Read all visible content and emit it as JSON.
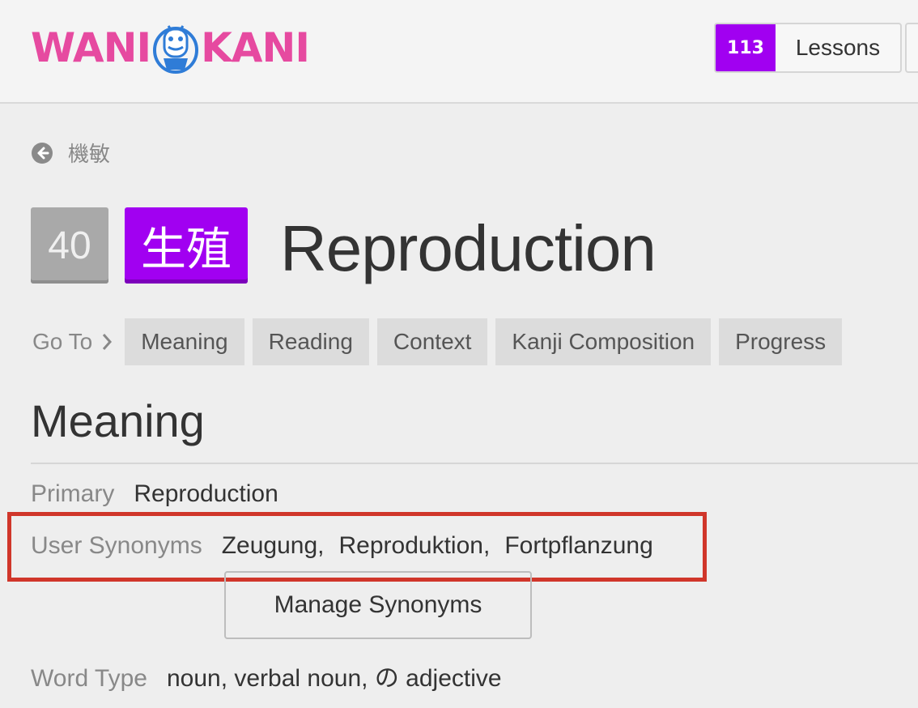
{
  "header": {
    "logo_left": "WANI",
    "logo_right": "KANI",
    "lessons_count": "113",
    "lessons_label": "Lessons"
  },
  "breadcrumb": {
    "icon": "arrow-left-circle-icon",
    "label": "機敏"
  },
  "item": {
    "level": "40",
    "characters": "生殖",
    "title": "Reproduction",
    "accent_color": "#a100f1"
  },
  "goto": {
    "label": "Go To",
    "tabs": [
      "Meaning",
      "Reading",
      "Context",
      "Kanji Composition",
      "Progress"
    ]
  },
  "meaning": {
    "section_title": "Meaning",
    "primary_label": "Primary",
    "primary_value": "Reproduction",
    "synonyms_label": "User Synonyms",
    "synonyms": [
      "Zeugung,",
      "Reproduktion,",
      "Fortpflanzung"
    ],
    "manage_button": "Manage Synonyms",
    "word_type_label": "Word Type",
    "word_type_value": "noun, verbal noun, の adjective",
    "highlight_color": "#d0362a"
  }
}
